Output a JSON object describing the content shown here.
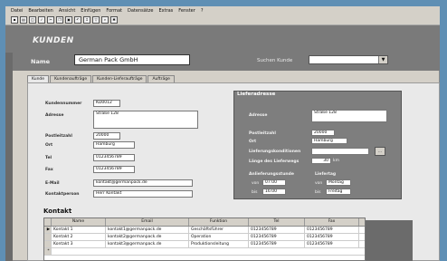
{
  "menu": [
    "Datei",
    "Bearbeiten",
    "Ansicht",
    "Einfügen",
    "Format",
    "Datensätze",
    "Extras",
    "Fenster",
    "?"
  ],
  "toolbar_icons": [
    "save-icon",
    "print-icon",
    "preview-icon",
    "spell-icon",
    "cut-icon",
    "copy-icon",
    "paste-icon",
    "undo-icon",
    "sort-icon",
    "filter-icon",
    "find-icon",
    "new-record-icon"
  ],
  "form": {
    "title": "KUNDEN",
    "name_label": "Name",
    "name_value": "German Pack GmbH",
    "search_label": "Suchen Kunde",
    "search_value": ""
  },
  "tabs": [
    "Kunde",
    "Kundenaufträge",
    "Kunden-Lieferaufträge",
    "Aufträge"
  ],
  "fields": {
    "kundennummer": {
      "label": "Kundennummer",
      "value": "KD0012"
    },
    "adresse": {
      "label": "Adresse",
      "value": "Straße 128"
    },
    "postleitzahl": {
      "label": "Postleitzahl",
      "value": "20000"
    },
    "ort": {
      "label": "Ort",
      "value": "Hamburg"
    },
    "tel": {
      "label": "Tel",
      "value": "0123456789"
    },
    "fax": {
      "label": "Fax",
      "value": "0123456789"
    },
    "email": {
      "label": "E-Mail",
      "value": "kontakt@germanpack.de"
    },
    "kontaktperson": {
      "label": "Kontaktperson",
      "value": "Herr Kontakt"
    }
  },
  "lieferadresse": {
    "title": "Lieferadresse",
    "adresse": {
      "label": "Adresse",
      "value": "Straße 128"
    },
    "postleitzahl": {
      "label": "Postleitzahl",
      "value": "20000"
    },
    "ort": {
      "label": "Ort",
      "value": "Hamburg"
    },
    "lieferungskonditionen": {
      "label": "Lieferungskonditionen",
      "value": ""
    },
    "lieferfrist": {
      "label": "Länge des Lieferwegs",
      "value": "30",
      "unit": "km"
    },
    "btn": "...",
    "anlieferungs_heading": "Anlieferungsstunde",
    "liefertag_heading": "Liefertag",
    "von_label": "von",
    "bis_label": "bis",
    "von_time": "07:00",
    "bis_time": "16:00",
    "von_day": "Montag",
    "bis_day": "Freitag"
  },
  "kontakt": {
    "title": "Kontakt",
    "columns": [
      "Name",
      "Email",
      "Funktion",
      "Tel",
      "Fax"
    ],
    "rows": [
      [
        "Kontakt 1",
        "kontakt1@germanpack.de",
        "Geschäftsführer",
        "0123456789",
        "0123456789"
      ],
      [
        "Kontakt 2",
        "kontakt2@germanpack.de",
        "Operation",
        "0123456789",
        "0123456789"
      ],
      [
        "Kontakt 3",
        "kontakt3@germanpack.de",
        "Produktionsleitung",
        "0123456789",
        "0123456789"
      ]
    ],
    "new_row_marker": "*"
  }
}
